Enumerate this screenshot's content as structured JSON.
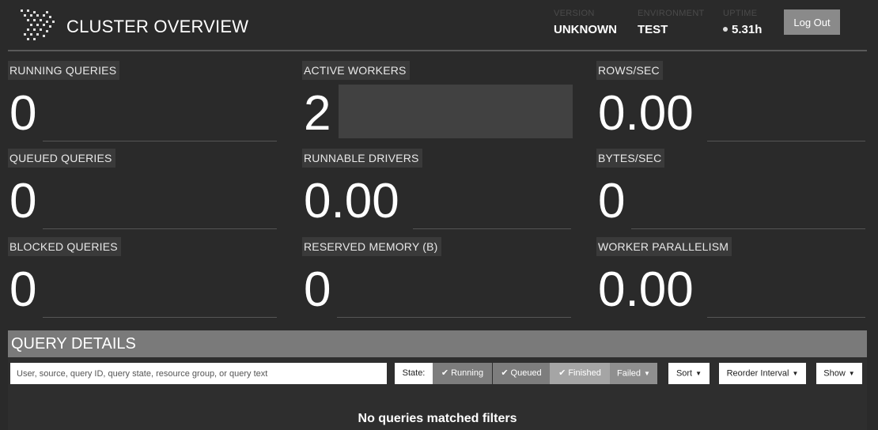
{
  "header": {
    "title": "CLUSTER OVERVIEW",
    "version": {
      "label": "VERSION",
      "value": "UNKNOWN"
    },
    "environment": {
      "label": "ENVIRONMENT",
      "value": "TEST"
    },
    "uptime": {
      "label": "UPTIME",
      "value": "5.31h"
    },
    "logout_label": "Log Out"
  },
  "stats": {
    "running_queries": {
      "label": "RUNNING QUERIES",
      "value": "0"
    },
    "active_workers": {
      "label": "ACTIVE WORKERS",
      "value": "2"
    },
    "rows_sec": {
      "label": "ROWS/SEC",
      "value": "0.00"
    },
    "queued_queries": {
      "label": "QUEUED QUERIES",
      "value": "0"
    },
    "runnable_drivers": {
      "label": "RUNNABLE DRIVERS",
      "value": "0.00"
    },
    "bytes_sec": {
      "label": "BYTES/SEC",
      "value": "0"
    },
    "blocked_queries": {
      "label": "BLOCKED QUERIES",
      "value": "0"
    },
    "reserved_memory": {
      "label": "RESERVED MEMORY (B)",
      "value": "0"
    },
    "worker_parallelism": {
      "label": "WORKER PARALLELISM",
      "value": "0.00"
    }
  },
  "query_details": {
    "title": "QUERY DETAILS",
    "search_placeholder": "User, source, query ID, query state, resource group, or query text",
    "state_label": "State:",
    "state_filters": {
      "running": "Running",
      "queued": "Queued",
      "finished": "Finished",
      "failed": "Failed"
    },
    "sort_label": "Sort",
    "reorder_label": "Reorder Interval",
    "show_label": "Show",
    "empty_message": "No queries matched filters"
  },
  "colors": {
    "background": "#2a2a2a",
    "panel_header": "#7a7a7a",
    "filter_active": "#7d7d7d",
    "filter_inactive": "#a5a5a5"
  }
}
